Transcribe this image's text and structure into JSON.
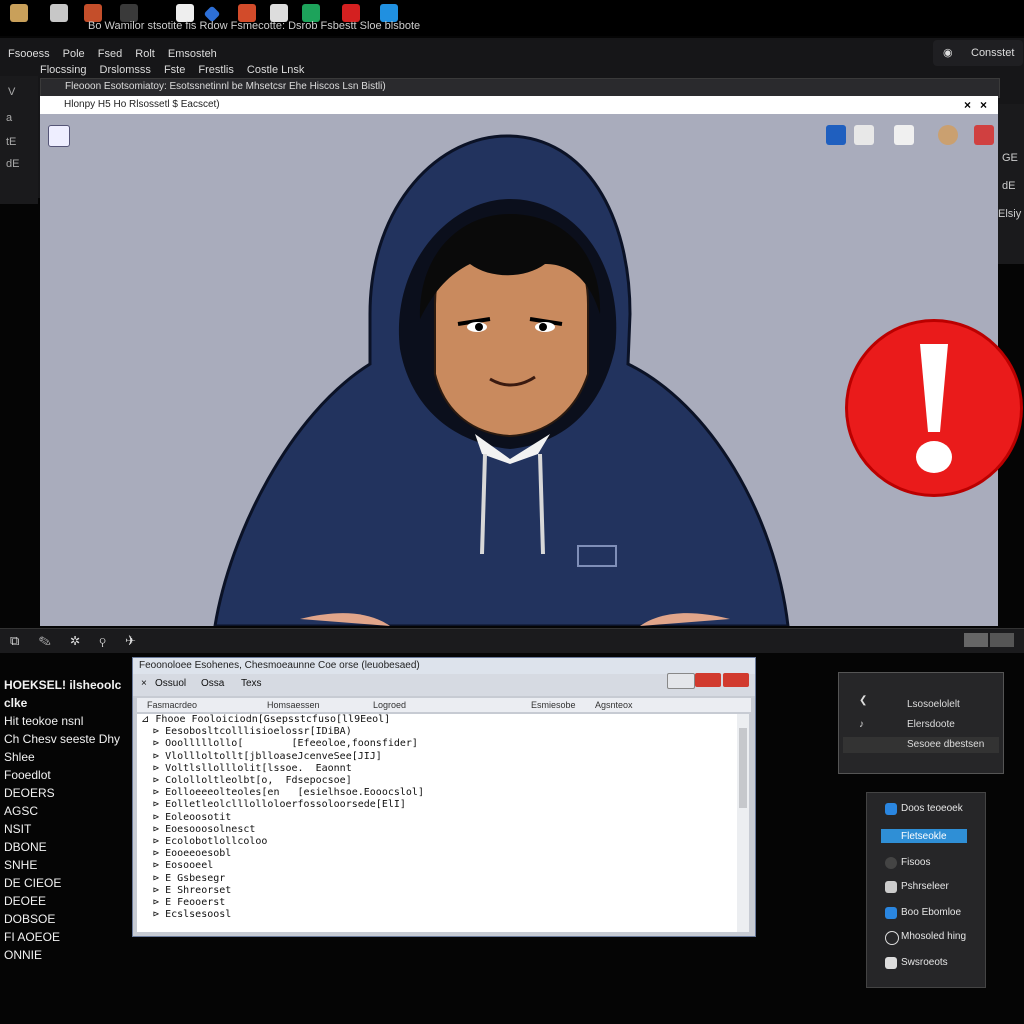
{
  "topbar": {
    "text": "Bo Wamilor stsotite fis Rdow Fsmecotte: Dsrob Fsbestt Sloe blsbote"
  },
  "menu": {
    "row1": [
      "Fsooess",
      "Pole",
      "Fsed",
      "Rolt",
      "Emsosteh"
    ],
    "row2": [
      "Flocssing",
      "Drslomsss",
      "Fste",
      "Frestlis",
      "Costle Lnsk"
    ],
    "right_pill": "Consstet"
  },
  "browser": {
    "tabstrip_text": "Fleooon Esotsomiatoy: Esotssnetinnl be Mhsetcsr Ehe Hiscos Lsn Bistli)",
    "url_text": "Hlonpy  H5  Ho  Rlsossetl  $  Eacscet)",
    "close": "×"
  },
  "left_panel": [
    "V",
    "a",
    "tE",
    "dE"
  ],
  "right_panel": [
    "GE",
    "dE",
    "Elsiy"
  ],
  "midbar_icons": "⧉ ✎ ✲ ⚲ ✈",
  "left_list": {
    "title": "HOEKSEL! ilsheoolc clke",
    "items": [
      "Hit teokoe nsnl",
      "Ch Chesv seeste Dhy Shlee",
      "Fooedlot",
      "DEOERS",
      "AGSC",
      "NSIT",
      "DBONE",
      "SNHE",
      "DE CIEOE",
      "DEOEE",
      "DOBSOE",
      "FI AOEOE",
      "ONNIE"
    ]
  },
  "dialog": {
    "title": "Feoonoloee Esohenes, Chesmoeaunne Coe orse (leuobesaed)",
    "tabs": [
      "Ossuol",
      "Ossa",
      "Texs"
    ],
    "columns": [
      "Fasmacrdeo",
      "Homsaessen",
      "Logroed",
      "Esmiesobe",
      "Agsnteox"
    ],
    "tree": [
      "Fhooe Fooloiciodn[Gsepsstcfuso[ll9Eeol]",
      "  Eesobosltcolllisioelossr[IDiBA)",
      "  Ooolllllollo[        [Efeeoloe,foonsfider]",
      "  Vlollloltollt[jblloaseJcenveSee[JIJ]",
      "  Voltlsllolllolit[lssoe.  Eaonnt",
      "  Cololloltleolbt[o,  Fdsepocsoe]",
      "  Eolloeeeolteoles[en   [esielhsoe.Eooocslol]",
      "  Eolletleolclllolloloerfossoloorsede[ElI]",
      "  Eoleoosotit",
      "  Eoesooosolnesct",
      "  Ecolobotlollcoloo",
      "  Eooeeoesobl",
      "  Eosooeel",
      "  E Gsbesegr",
      "  E Shreorset",
      "  E Feooerst",
      "  Ecslsesoosl"
    ]
  },
  "popup1": {
    "items": [
      "Lsosoelolelt",
      "Elersdoote",
      "Sesoee dbestsen"
    ]
  },
  "popup2": {
    "items": [
      "Doos teoeoek",
      "Fletseokle",
      "Fisoos",
      "Pshrseleer",
      "Boo Ebomloe",
      "Mhosoled hing",
      "Swsroeots"
    ]
  },
  "colors": {
    "accent": "#2e6fd0",
    "alert": "#ea1b1b",
    "hoodie": "#22335e",
    "canvas": "#a9acbc"
  }
}
